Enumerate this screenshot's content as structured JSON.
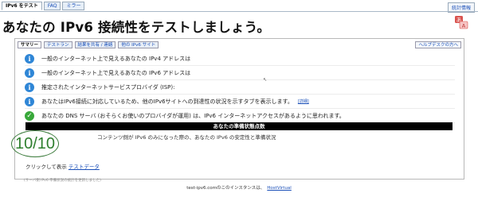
{
  "top_tabs": [
    "IPv6 をテスト",
    "FAQ",
    "ミラー"
  ],
  "stats_link": "統計情報",
  "page_title": "あなたの IPv6 接続性をテストしましょう。",
  "sub_tabs": [
    "サマリー",
    "テストラン",
    "結果を共有 / 連絡",
    "他の IPv6 サイト"
  ],
  "help_tab": "ヘルプデスクの方へ",
  "rows": [
    {
      "icon": "info-icon",
      "text": "一般のインターネット上で見えるあなたの IPv4 アドレスは"
    },
    {
      "icon": "info-icon",
      "text": "一般のインターネット上で見えるあなたの IPv6 アドレスは"
    },
    {
      "icon": "info-icon",
      "text": "推定されたインターネットサービスプロバイダ (ISP):"
    },
    {
      "icon": "info-icon",
      "text": "あなたはIPv6接続に対応しているため、他のIPv6サイトへの到達性の状況を示すタブを表示します。",
      "detail": "[詳細]"
    },
    {
      "icon": "check-icon",
      "text": "あなたの DNS サーバ (おそらくお使いのプロバイダが運用) は、IPv6 インターネットアクセスがあるように思われます。"
    }
  ],
  "readiness_title": "あなたの準備状態点数",
  "score": "10/10",
  "score_caption": "コンテンツ側が IPv6 のみになった際の、あなたの IPv6 の安定性と準備状況",
  "click_show_label": "クリックして表示",
  "test_data_link": "テストデータ",
  "footnote": "(サーバ側 IPv6 準備状況の統計を更新しました)",
  "footer_text": "test-ipv6.comのこのインスタンスは、",
  "footer_link": "HostVirtual",
  "colors": {
    "info": "#2f86d6",
    "ok": "#38a83a",
    "score": "#2f7f2f",
    "link": "#1a4fb8"
  }
}
